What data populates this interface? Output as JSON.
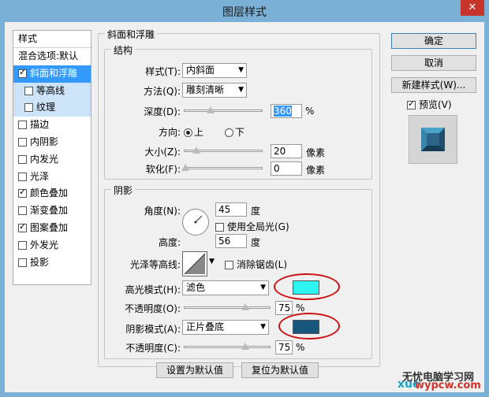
{
  "window": {
    "title": "图层样式",
    "close": "✕"
  },
  "styles_list": {
    "header": "样式",
    "blend_default": "混合选项:默认",
    "items": [
      {
        "label": "斜面和浮雕",
        "checked": true
      },
      {
        "label": "等高线",
        "checked": false
      },
      {
        "label": "纹理",
        "checked": false
      },
      {
        "label": "描边",
        "checked": false
      },
      {
        "label": "内阴影",
        "checked": false
      },
      {
        "label": "内发光",
        "checked": false
      },
      {
        "label": "光泽",
        "checked": false
      },
      {
        "label": "颜色叠加",
        "checked": true
      },
      {
        "label": "渐变叠加",
        "checked": false
      },
      {
        "label": "图案叠加",
        "checked": true
      },
      {
        "label": "外发光",
        "checked": false
      },
      {
        "label": "投影",
        "checked": false
      }
    ]
  },
  "bevel": {
    "title": "斜面和浮雕",
    "structure": {
      "title": "结构",
      "style_label": "样式(T):",
      "style_value": "内斜面",
      "technique_label": "方法(Q):",
      "technique_value": "雕刻清晰",
      "depth_label": "深度(D):",
      "depth_value": "360",
      "depth_unit": "%",
      "direction_label": "方向:",
      "direction_up": "上",
      "direction_down": "下",
      "size_label": "大小(Z):",
      "size_value": "20",
      "size_unit": "像素",
      "soften_label": "软化(F):",
      "soften_value": "0",
      "soften_unit": "像素"
    },
    "shading": {
      "title": "阴影",
      "angle_label": "角度(N):",
      "angle_value": "45",
      "angle_unit": "度",
      "global_light": "使用全局光(G)",
      "altitude_label": "高度:",
      "altitude_value": "56",
      "altitude_unit": "度",
      "gloss_contour_label": "光泽等高线:",
      "anti_alias": "消除锯齿(L)",
      "highlight_mode_label": "高光模式(H):",
      "highlight_mode_value": "滤色",
      "highlight_color": "#2ef5f2",
      "highlight_opacity_label": "不透明度(O):",
      "highlight_opacity_value": "75",
      "opacity_unit": "%",
      "shadow_mode_label": "阴影模式(A):",
      "shadow_mode_value": "正片叠底",
      "shadow_color": "#17567d",
      "shadow_opacity_label": "不透明度(C):",
      "shadow_opacity_value": "75"
    },
    "make_default": "设置为默认值",
    "reset_default": "复位为默认值"
  },
  "buttons": {
    "ok": "确定",
    "cancel": "取消",
    "new_style": "新建样式(W)...",
    "preview": "预览(V)"
  },
  "watermark": {
    "line1": "无忧电脑学习网",
    "line2": "wypcw.com",
    "brand": "xue"
  },
  "colors": {
    "title_bar": "#7ab0d6",
    "selected": "#3399ff",
    "annotation": "#cc1111"
  }
}
